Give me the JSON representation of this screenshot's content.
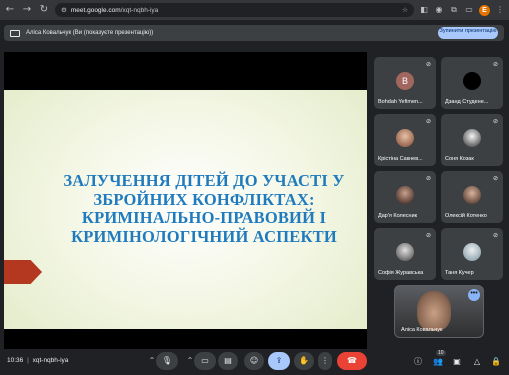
{
  "browser": {
    "url_host": "meet.google.com",
    "url_path": "/xqt-nqbh-iya",
    "profile_initial": "E",
    "icons": [
      "back-icon",
      "forward-icon",
      "reload-icon",
      "site-info-icon",
      "star-icon",
      "extensions-icon",
      "profile-icon",
      "menu-icon"
    ]
  },
  "banner": {
    "text": "Аліса Ковальчук (Ви (показуєте презентацію))",
    "stop_button": "Зупинити презентацію"
  },
  "slide": {
    "title": "ЗАЛУЧЕННЯ ДІТЕЙ ДО УЧАСТІ У ЗБРОЙНИХ КОНФЛІКТАХ: КРИМІНАЛЬНО-ПРАВОВИЙ І КРИМІНОЛОГІЧНИЙ АСПЕКТИ"
  },
  "participants": [
    {
      "name": "Bohdah Yefimen...",
      "initial": "B",
      "avatar_color": "#a1665e"
    },
    {
      "name": "Дзанд Студене...",
      "initial": "",
      "avatar_color": "#000000"
    },
    {
      "name": "Крістіна Сакнев...",
      "initial": "",
      "avatar_color": "#c58a73"
    },
    {
      "name": "Соня Козак",
      "initial": "",
      "avatar_color": "#d9d9d9"
    },
    {
      "name": "Дар'я Колесник",
      "initial": "",
      "avatar_color": "#6d4c41"
    },
    {
      "name": "Олексій Котенко",
      "initial": "",
      "avatar_color": "#8d6e63"
    },
    {
      "name": "Софія Журавська",
      "initial": "",
      "avatar_color": "#9e9e9e"
    },
    {
      "name": "Таня Кучер",
      "initial": "",
      "avatar_color": "#cfd8dc"
    }
  ],
  "self_view": {
    "name": "Аліса Ковальчук",
    "more": "•••"
  },
  "meeting": {
    "time": "10:36",
    "separator": "|",
    "code": "xqt-nqbh-iya",
    "participant_count": "10"
  },
  "controls": {
    "mic": "🎙",
    "camera": "▭",
    "captions": "▤",
    "emoji": "☺",
    "present": "⇪",
    "hand": "✋",
    "more": "⋮",
    "end": "☎",
    "info": "ⓘ",
    "people": "👥",
    "chat": "▣",
    "activities": "△",
    "host": "🔒"
  }
}
